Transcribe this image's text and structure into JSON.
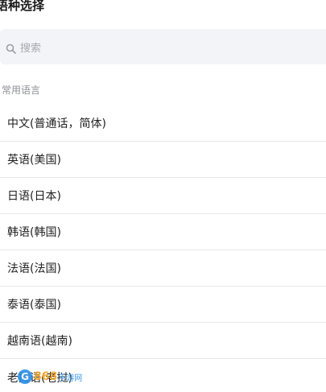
{
  "header": {
    "title": "语种选择"
  },
  "search": {
    "placeholder": "搜索"
  },
  "section": {
    "label": "常用语言"
  },
  "languages": [
    {
      "label": "中文(普通话，简体)"
    },
    {
      "label": "英语(美国)"
    },
    {
      "label": "日语(日本)"
    },
    {
      "label": "韩语(韩国)"
    },
    {
      "label": "法语(法国)"
    },
    {
      "label": "泰语(泰国)"
    },
    {
      "label": "越南语(越南)"
    },
    {
      "label": "老挝语(老挝)"
    }
  ],
  "watermark": {
    "logo_letter": "G",
    "number": "868",
    "text": "手游网"
  },
  "colors": {
    "search_bg": "#f2f4f7",
    "divider": "#e6e7ea",
    "muted_text": "#8c8f94",
    "watermark_blue": "#2a8fe6",
    "watermark_orange": "#f5a623"
  },
  "icons": {
    "search": "search-icon"
  }
}
